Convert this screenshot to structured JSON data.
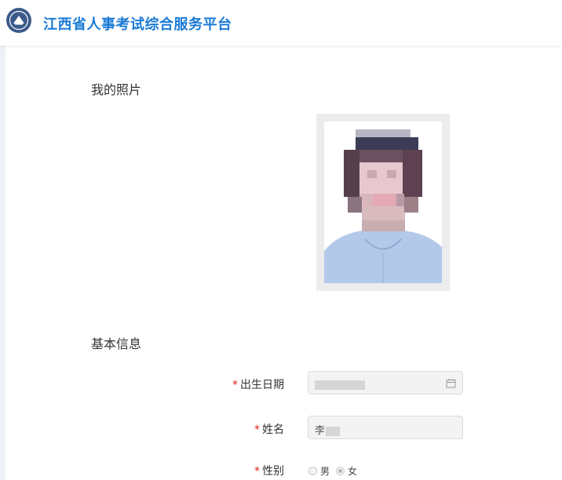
{
  "header": {
    "site_title": "江西省人事考试综合服务平台",
    "logo_icon": "provincial-emblem-icon"
  },
  "photo_section": {
    "title": "我的照片"
  },
  "basic_info": {
    "title": "基本信息",
    "fields": {
      "birth_date": {
        "required_mark": "*",
        "label": "出生日期",
        "icon": "calendar-icon"
      },
      "name": {
        "required_mark": "*",
        "label": "姓名",
        "value": "李"
      },
      "gender": {
        "required_mark": "*",
        "label": "性别",
        "options": [
          "男",
          "女"
        ],
        "selected": "女"
      }
    }
  },
  "colors": {
    "brand_blue": "#1a7ad6",
    "required_red": "#e02020",
    "photo_background": "#b4c8ea"
  }
}
